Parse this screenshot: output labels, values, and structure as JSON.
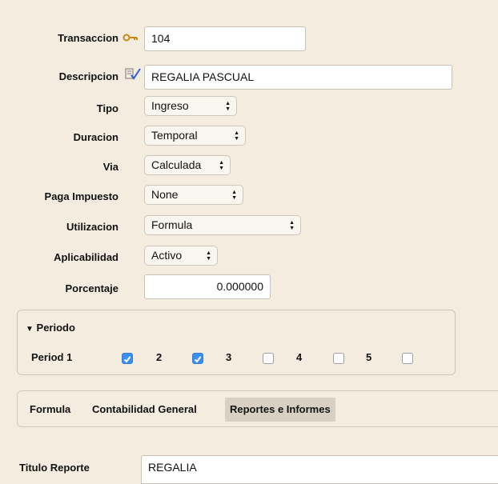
{
  "form": {
    "transaccion": {
      "label": "Transaccion",
      "value": "104"
    },
    "descripcion": {
      "label": "Descripcion",
      "value": "REGALIA PASCUAL"
    },
    "tipo": {
      "label": "Tipo",
      "value": "Ingreso"
    },
    "duracion": {
      "label": "Duracion",
      "value": "Temporal"
    },
    "via": {
      "label": "Via",
      "value": "Calculada"
    },
    "paga_impuesto": {
      "label": "Paga Impuesto",
      "value": "None"
    },
    "utilizacion": {
      "label": "Utilizacion",
      "value": "Formula"
    },
    "aplicabilidad": {
      "label": "Aplicabilidad",
      "value": "Activo"
    },
    "porcentaje": {
      "label": "Porcentaje",
      "value": "0.000000"
    }
  },
  "periodo": {
    "title": "Periodo",
    "items": [
      {
        "label": "Period 1",
        "checked": true
      },
      {
        "label": "2",
        "checked": true
      },
      {
        "label": "3",
        "checked": false
      },
      {
        "label": "4",
        "checked": false
      },
      {
        "label": "5",
        "checked": false
      }
    ]
  },
  "tabs": [
    {
      "label": "Formula",
      "active": false
    },
    {
      "label": "Contabilidad General",
      "active": false
    },
    {
      "label": "Reportes e Informes",
      "active": true
    }
  ],
  "reporte": {
    "label": "Titulo Reporte",
    "value": "REGALIA"
  },
  "icons": {
    "transaccion": "key-icon",
    "descripcion": "edit-checklist-icon",
    "select_arrows": "updown-arrows-icon",
    "disclosure": "triangle-down-icon",
    "checkmark": "checkmark-icon"
  },
  "colors": {
    "background": "#f4eddf",
    "checkbox_on": "#3b8ff0",
    "tab_active": "#d8d1c3"
  }
}
